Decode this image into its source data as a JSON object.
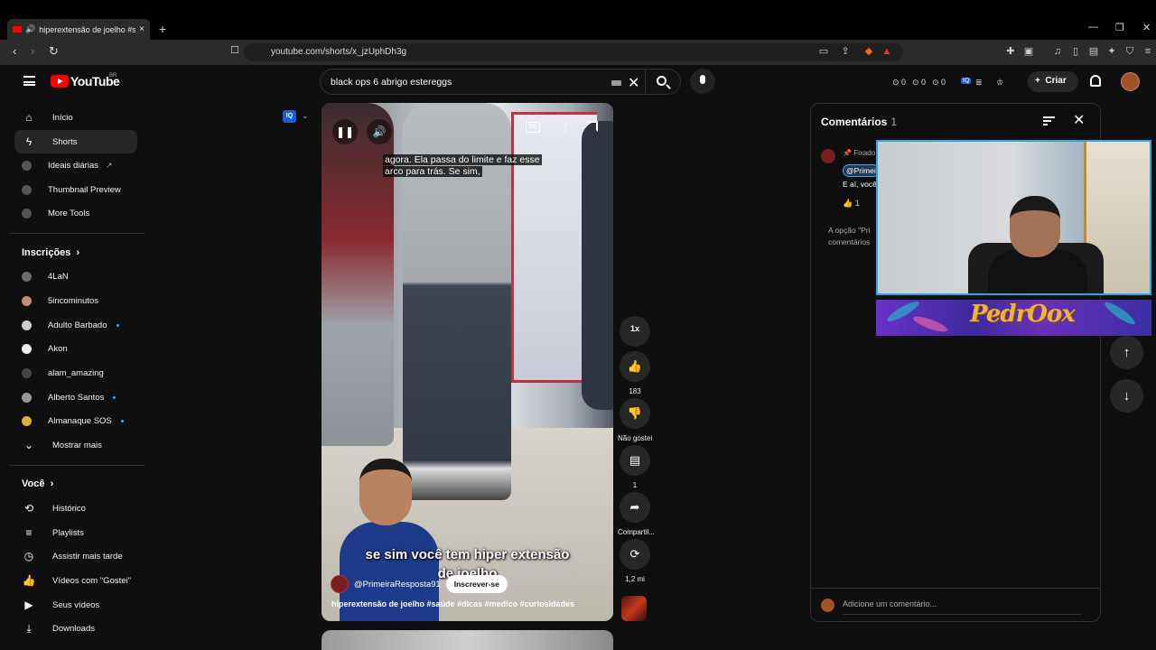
{
  "browser": {
    "tab_title": "hiperextensão de joelho #saúde",
    "url": "youtube.com/shorts/x_jzUphDh3g",
    "new_tab": "+",
    "tab_close": "×"
  },
  "header": {
    "logo_text": "YouTube",
    "country_code": "BR",
    "search_query": "black ops 6 abrigo estereggs",
    "counters": [
      "0",
      "0",
      "0"
    ],
    "create_label": "Criar"
  },
  "sidebar": {
    "main": [
      {
        "label": "Início",
        "icon": "home-icon"
      },
      {
        "label": "Shorts",
        "icon": "shorts-icon"
      },
      {
        "label": "Ideais diárias",
        "icon": "extension-icon"
      },
      {
        "label": "Thumbnail Preview",
        "icon": "extension-icon"
      },
      {
        "label": "More Tools",
        "icon": "extension-icon"
      }
    ],
    "subscriptions_title": "Inscrições",
    "subscriptions": [
      {
        "label": "4LaN"
      },
      {
        "label": "5incominutos"
      },
      {
        "label": "Adulto Barbado"
      },
      {
        "label": "Akon"
      },
      {
        "label": "alam_amazing"
      },
      {
        "label": "Alberto Santos"
      },
      {
        "label": "Almanaque SOS"
      }
    ],
    "show_more": "Mostrar mais",
    "you_title": "Você",
    "you": [
      {
        "label": "Histórico"
      },
      {
        "label": "Playlists"
      },
      {
        "label": "Assistir mais tarde"
      },
      {
        "label": "Vídeos com \"Gostei\""
      },
      {
        "label": "Seus vídeos"
      },
      {
        "label": "Downloads"
      }
    ]
  },
  "video": {
    "caption_line1": "agora. Ela passa do limite e faz esse",
    "caption_line2": "arco para trás. Se sim,",
    "subtitle_line1": "se sim você tem hiper extensão",
    "subtitle_line2": "de joelho",
    "channel": "@PrimeiraResposta91",
    "subscribe": "Inscrever-se",
    "title": "hiperextensão de joelho",
    "tags": "#saúde #dicas #medico #curiosidades",
    "cc_label": "CC",
    "iq_badge": "IQ"
  },
  "actions": {
    "speed": "1x",
    "likes": "183",
    "dislike": "Não gostei",
    "comments": "1",
    "share": "Compartil...",
    "remix": "1,2 mi"
  },
  "comments": {
    "title": "Comentários",
    "count": "1",
    "pinned": "Fixado p",
    "mention": "@Primei",
    "text": "E aí, você",
    "likes": "1",
    "note": "A opção \"Pri comentários",
    "add_placeholder": "Adicione um comentário..."
  },
  "overlay": {
    "banner_text": "PedrOox"
  }
}
